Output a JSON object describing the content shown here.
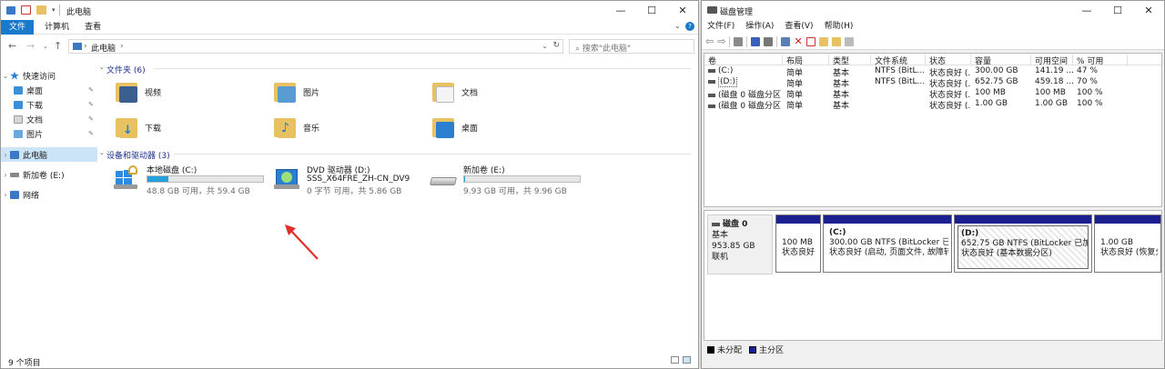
{
  "explorer": {
    "title": "此电脑",
    "tabs": [
      "文件",
      "计算机",
      "查看"
    ],
    "address": "此电脑",
    "search_placeholder": "搜索\"此电脑\"",
    "nav": {
      "quick_access": "快速访问",
      "pinned": [
        "桌面",
        "下载",
        "文档",
        "图片"
      ],
      "this_pc": "此电脑",
      "new_volume": "新加卷 (E:)",
      "network": "网络"
    },
    "folders_section": "文件夹 (6)",
    "folders": [
      "视频",
      "图片",
      "文档",
      "下载",
      "音乐",
      "桌面"
    ],
    "devices_section": "设备和驱动器 (3)",
    "drives": [
      {
        "name": "本地磁盘 (C:)",
        "size_text": "48.8 GB 可用，共 59.4 GB",
        "used_fraction": 0.18
      },
      {
        "name": "DVD 驱动器 (D:)",
        "sub": "SSS_X64FRE_ZH-CN_DV9",
        "size_text": "0 字节 可用，共 5.86 GB"
      },
      {
        "name": "新加卷 (E:)",
        "size_text": "9.93 GB 可用，共 9.96 GB",
        "used_fraction": 0.004
      }
    ],
    "status_count": "9 个项目"
  },
  "disk_mgmt": {
    "title": "磁盘管理",
    "menu": [
      "文件(F)",
      "操作(A)",
      "查看(V)",
      "帮助(H)"
    ],
    "columns": [
      "卷",
      "布局",
      "类型",
      "文件系统",
      "状态",
      "容量",
      "可用空间",
      "% 可用"
    ],
    "rows": [
      [
        "(C:)",
        "简单",
        "基本",
        "NTFS (BitL...",
        "状态良好 (...",
        "300.00 GB",
        "141.19 ...",
        "47 %"
      ],
      [
        "(D:)",
        "简单",
        "基本",
        "NTFS (BitL...",
        "状态良好 (...",
        "652.75 GB",
        "459.18 ...",
        "70 %"
      ],
      [
        "(磁盘 0 磁盘分区 1)",
        "简单",
        "基本",
        "",
        "状态良好 (...",
        "100 MB",
        "100 MB",
        "100 %"
      ],
      [
        "(磁盘 0 磁盘分区 5)",
        "简单",
        "基本",
        "",
        "状态良好 (...",
        "1.00 GB",
        "1.00 GB",
        "100 %"
      ]
    ],
    "disk": {
      "name": "磁盘 0",
      "type": "基本",
      "size": "953.85 GB",
      "status": "联机"
    },
    "partitions": [
      {
        "title": "",
        "line1": "100 MB",
        "line2": "状态良好 (E"
      },
      {
        "title": "(C:)",
        "line1": "300.00 GB NTFS (BitLocker 已加密)",
        "line2": "状态良好 (启动, 页面文件, 故障转储, 主"
      },
      {
        "title": "(D:)",
        "line1": "652.75 GB NTFS (BitLocker 已加密)",
        "line2": "状态良好 (基本数据分区)"
      },
      {
        "title": "",
        "line1": "1.00 GB",
        "line2": "状态良好 (恢复分"
      }
    ],
    "legend": [
      "未分配",
      "主分区"
    ],
    "colors": {
      "unallocated": "#000000",
      "primary": "#1b1f8f"
    }
  }
}
